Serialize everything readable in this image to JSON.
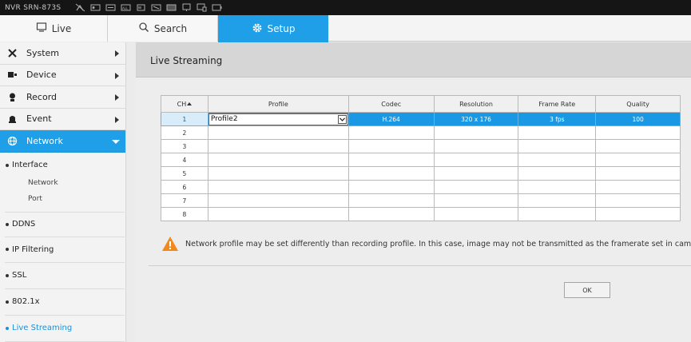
{
  "topbar": {
    "brand": "NVR SRN-873S",
    "icons": [
      "network-off-icon",
      "record-icon",
      "record-list-icon",
      "record-all-icon",
      "hdd-icon",
      "hdd-error-icon",
      "monitor-icon",
      "display-icon",
      "battery-icon"
    ]
  },
  "tabs": [
    {
      "label": "Live",
      "icon": "monitor-icon"
    },
    {
      "label": "Search",
      "icon": "search-icon"
    },
    {
      "label": "Setup",
      "icon": "gear-icon"
    }
  ],
  "sidebar": {
    "menus": [
      {
        "label": "System",
        "icon": "tools-icon"
      },
      {
        "label": "Device",
        "icon": "device-icon"
      },
      {
        "label": "Record",
        "icon": "recorder-icon"
      },
      {
        "label": "Event",
        "icon": "alarm-icon"
      },
      {
        "label": "Network",
        "icon": "globe-icon"
      }
    ],
    "submenu": {
      "interface": "Interface",
      "interface_children": [
        "Network",
        "Port"
      ],
      "ddns": "DDNS",
      "ip_filtering": "IP Filtering",
      "ssl": "SSL",
      "dot1x": "802.1x",
      "live_streaming": "Live Streaming"
    }
  },
  "content": {
    "title": "Live Streaming",
    "table": {
      "headers": [
        "CH",
        "Profile",
        "Codec",
        "Resolution",
        "Frame Rate",
        "Quality"
      ],
      "rows": [
        {
          "ch": "1",
          "profile": "Profile2",
          "codec": "H.264",
          "resolution": "320 x 176",
          "frame_rate": "3 fps",
          "quality": "100"
        },
        {
          "ch": "2",
          "profile": "",
          "codec": "",
          "resolution": "",
          "frame_rate": "",
          "quality": ""
        },
        {
          "ch": "3",
          "profile": "",
          "codec": "",
          "resolution": "",
          "frame_rate": "",
          "quality": ""
        },
        {
          "ch": "4",
          "profile": "",
          "codec": "",
          "resolution": "",
          "frame_rate": "",
          "quality": ""
        },
        {
          "ch": "5",
          "profile": "",
          "codec": "",
          "resolution": "",
          "frame_rate": "",
          "quality": ""
        },
        {
          "ch": "6",
          "profile": "",
          "codec": "",
          "resolution": "",
          "frame_rate": "",
          "quality": ""
        },
        {
          "ch": "7",
          "profile": "",
          "codec": "",
          "resolution": "",
          "frame_rate": "",
          "quality": ""
        },
        {
          "ch": "8",
          "profile": "",
          "codec": "",
          "resolution": "",
          "frame_rate": "",
          "quality": ""
        }
      ]
    },
    "notice": "Network profile may be set differently than recording profile. In this case, image may not be transmitted as the framerate set in camera.",
    "ok_label": "OK"
  },
  "colors": {
    "accent": "#1e9fe8",
    "topbar": "#151515",
    "warning": "#f08a1c"
  }
}
